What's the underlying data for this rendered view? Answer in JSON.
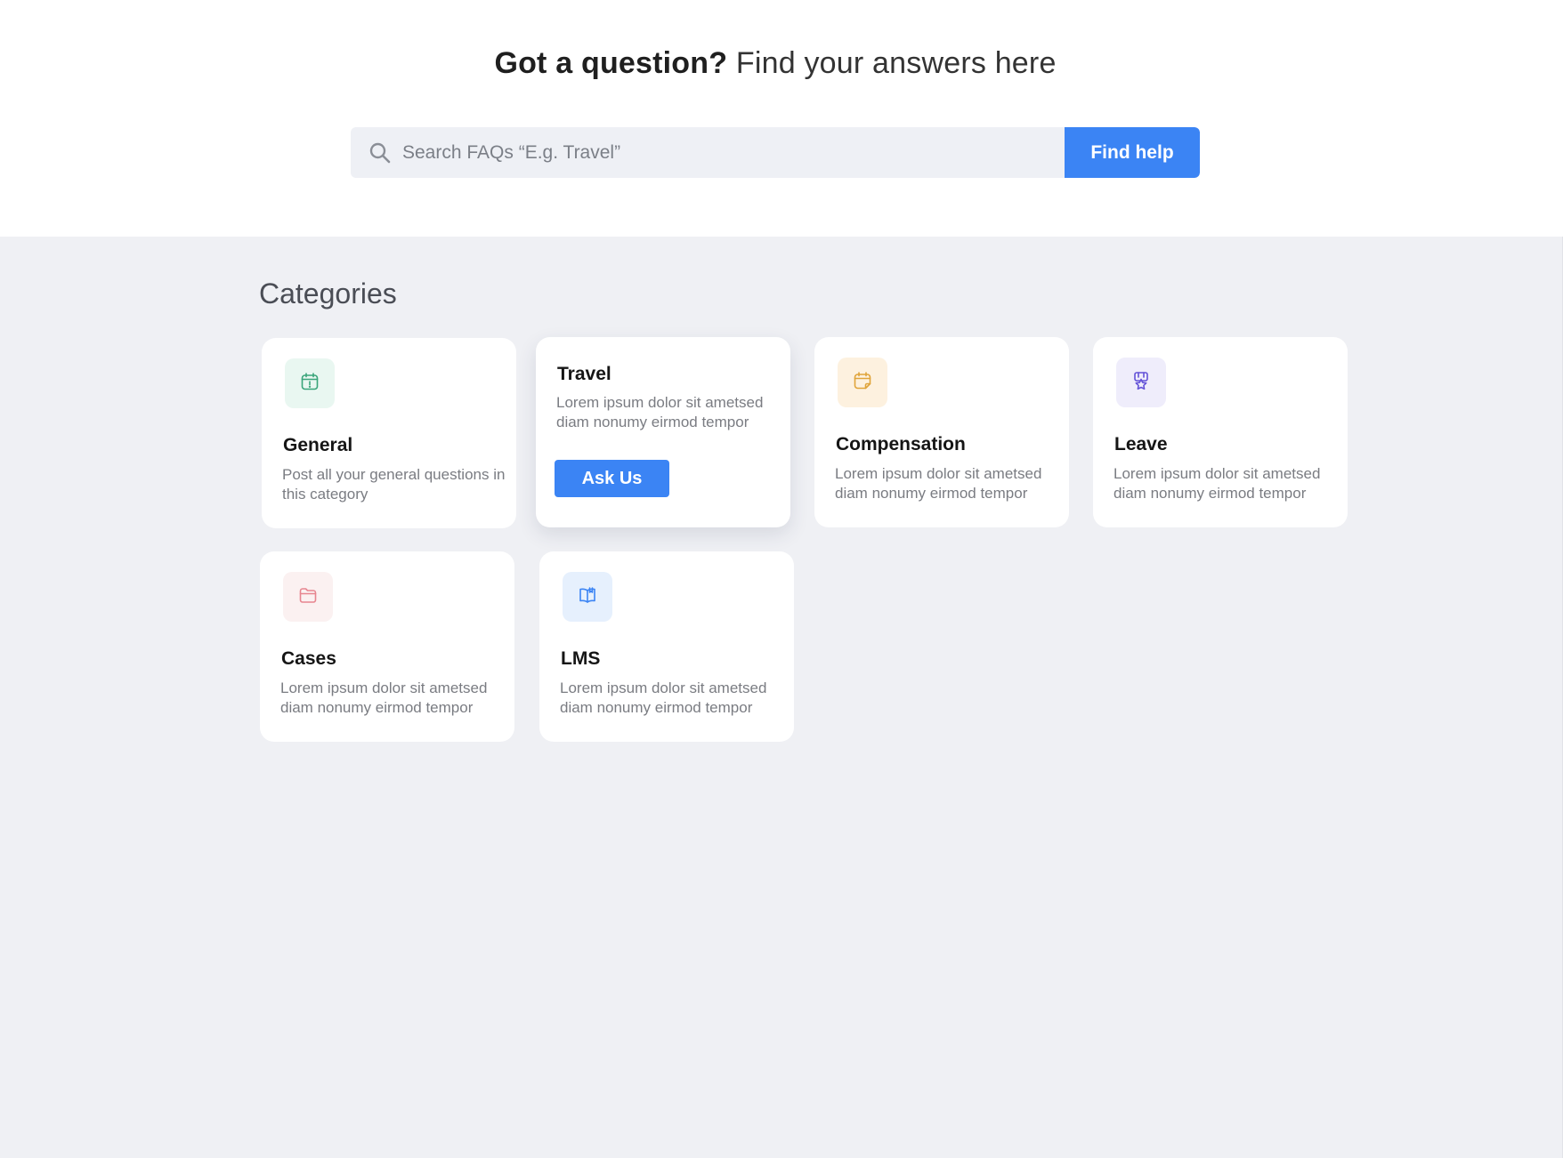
{
  "hero": {
    "title_strong": "Got a question?",
    "title_light": "Find your answers here",
    "search_placeholder": "Search FAQs “E.g. Travel”",
    "search_button": "Find help"
  },
  "categories_heading": "Categories",
  "categories": [
    {
      "name": "General",
      "description": "Post all your general questions in this category",
      "icon": "calendar-alert-icon",
      "icon_color": "#3aa57a",
      "tile_color": "#e9f7f1"
    },
    {
      "name": "Travel",
      "description": "Lorem ipsum dolor sit ametsed diam nonumy eirmod tempor",
      "action": "Ask Us"
    },
    {
      "name": "Compensation",
      "description": "Lorem ipsum dolor sit ametsed diam nonumy eirmod tempor",
      "icon": "calendar-note-icon",
      "icon_color": "#e0a43a",
      "tile_color": "#fdf1df"
    },
    {
      "name": "Leave",
      "description": "Lorem ipsum dolor sit ametsed diam nonumy eirmod tempor",
      "icon": "badge-icon",
      "icon_color": "#6453d8",
      "tile_color": "#efedfb"
    },
    {
      "name": "Cases",
      "description": "Lorem ipsum dolor sit ametsed diam nonumy eirmod tempor",
      "icon": "folder-icon",
      "icon_color": "#e7858f",
      "tile_color": "#fbf1f1"
    },
    {
      "name": "LMS",
      "description": "Lorem ipsum dolor sit ametsed diam nonumy eirmod tempor",
      "icon": "book-icon",
      "icon_color": "#3b84f4",
      "tile_color": "#e6f0fd"
    }
  ],
  "colors": {
    "accent": "#3b84f4",
    "page_background": "#eff0f4",
    "card_background": "#ffffff"
  }
}
